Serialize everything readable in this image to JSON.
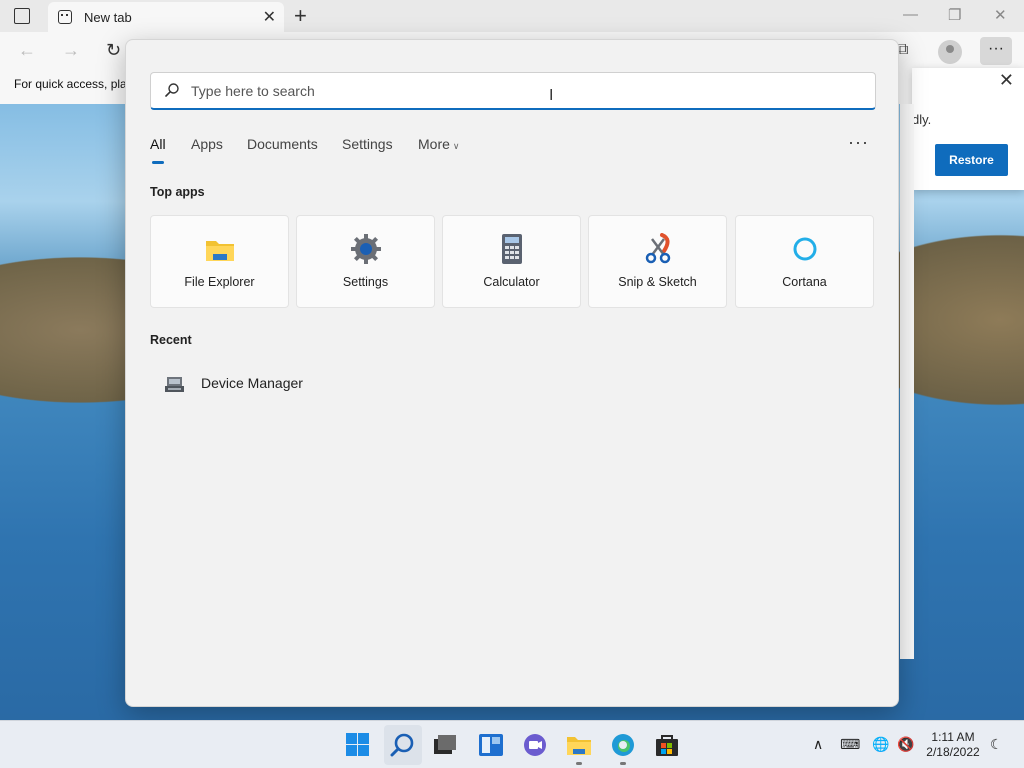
{
  "browser": {
    "tab_title": "New tab",
    "favbar_text": "For quick access, pla",
    "restore_popup": {
      "text": "dly.",
      "button": "Restore"
    }
  },
  "search": {
    "placeholder": "Type here to search",
    "filters": [
      "All",
      "Apps",
      "Documents",
      "Settings",
      "More"
    ],
    "active_filter": "All"
  },
  "top_apps": {
    "title": "Top apps",
    "items": [
      {
        "label": "File Explorer",
        "icon": "folder-icon"
      },
      {
        "label": "Settings",
        "icon": "gear-icon"
      },
      {
        "label": "Calculator",
        "icon": "calculator-icon"
      },
      {
        "label": "Snip & Sketch",
        "icon": "scissors-icon"
      },
      {
        "label": "Cortana",
        "icon": "cortana-ring-icon"
      }
    ]
  },
  "recent": {
    "title": "Recent",
    "items": [
      {
        "label": "Device Manager",
        "icon": "device-manager-icon"
      }
    ]
  },
  "taskbar": {
    "clock_time": "1:11 AM",
    "clock_date": "2/18/2022"
  },
  "colors": {
    "accent": "#0f6cbd"
  }
}
